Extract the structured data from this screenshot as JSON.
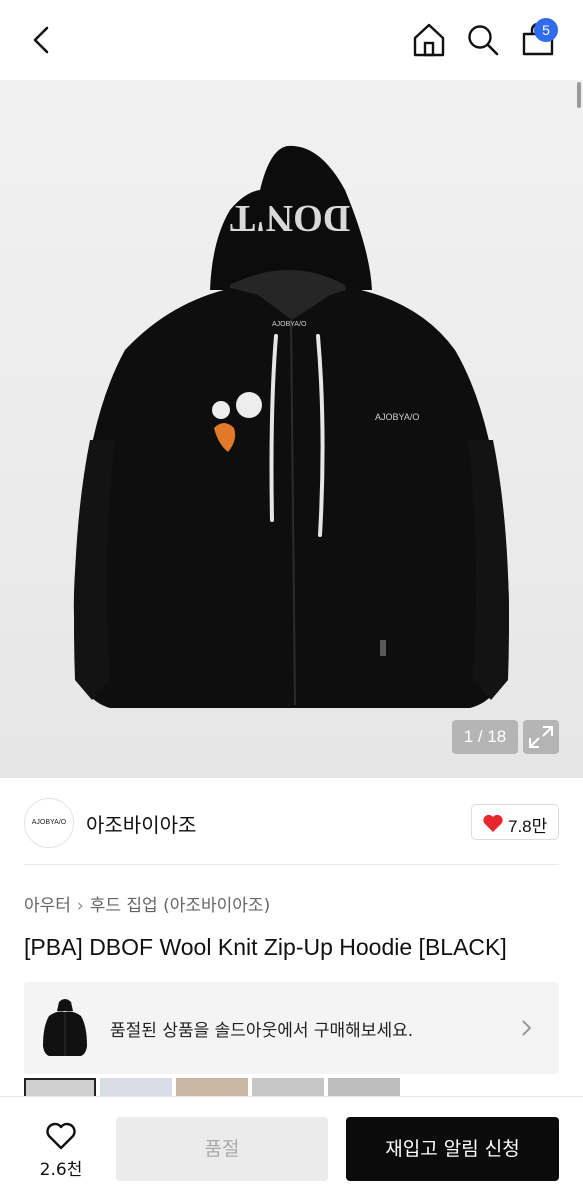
{
  "header": {
    "back_icon": "chevron-left-icon",
    "home_icon": "home-icon",
    "search_icon": "search-icon",
    "cart_icon": "shopping-bag-icon",
    "cart_badge": "5",
    "badge_color": "#2f6bea"
  },
  "gallery": {
    "counter": "1 / 18",
    "current_index": 1,
    "total": 18,
    "expand_icon": "expand-icon",
    "hood_text": "DON'T",
    "chest_text": "AJOBYA/O",
    "label_text": "AJOBYA/O"
  },
  "brand": {
    "logo_text": "AJOBYA/O",
    "name": "아조바이아조",
    "likes": "7.8만",
    "heart_color": "#e8262d"
  },
  "breadcrumb": {
    "level1": "아우터",
    "level2": "후드 집업 (아조바이아조)"
  },
  "product": {
    "title": "[PBA] DBOF Wool Knit Zip-Up Hoodie [BLACK]"
  },
  "soldout_banner": {
    "message": "품절된 상품을 솔드아웃에서 구매해보세요."
  },
  "bottom_bar": {
    "wish_count": "2.6천",
    "sold_out_label": "품절",
    "restock_label": "재입고 알림 신청"
  }
}
